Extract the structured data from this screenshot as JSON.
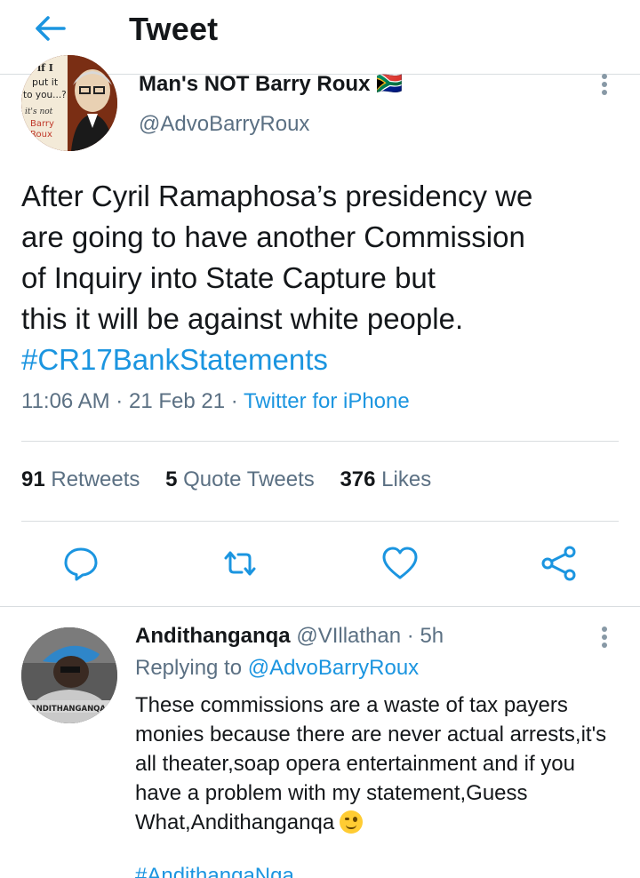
{
  "header": {
    "title": "Tweet",
    "back_icon": "arrow-left-icon"
  },
  "tweet": {
    "avatar_text": [
      "if I",
      "put it",
      "to you...?",
      "it's not",
      "Barry",
      "Roux"
    ],
    "display_name": "Man's NOT Barry Roux 🇿🇦",
    "handle": "@AdvoBarryRoux",
    "text_lines": [
      "After Cyril Ramaphosa’s presidency we",
      "are going to have another Commission",
      "of Inquiry into State Capture but",
      "this it will be against white people."
    ],
    "hashtag": "#CR17BankStatements",
    "time": "11:06 AM",
    "sep1": "·",
    "date": "21 Feb 21",
    "sep2": "·",
    "source": "Twitter for iPhone",
    "stats": {
      "retweets_count": "91",
      "retweets_label": "Retweets",
      "quotes_count": "5",
      "quotes_label": "Quote Tweets",
      "likes_count": "376",
      "likes_label": "Likes"
    },
    "action_icons": [
      "reply-icon",
      "retweet-icon",
      "like-icon",
      "share-icon"
    ]
  },
  "reply": {
    "avatar_text": "ANDITHANGANQA",
    "name": "Andithanganqa",
    "handle": "@VIllathan",
    "sep": "·",
    "time": "5h",
    "replying_prefix": "Replying to",
    "replying_handle": "@AdvoBarryRoux",
    "text_lines": [
      "These commissions are a waste of tax payers",
      "monies because there are never actual arrests,it's",
      "all theater,soap opera entertainment and if you",
      "have a problem with my statement,Guess",
      "What,Andithanganqa"
    ],
    "emoji": "winking-face-emoji",
    "hashtag": "#AndithangaNga"
  },
  "colors": {
    "accent": "#1b95e0",
    "text_primary": "#14171a",
    "text_secondary": "#5b7083",
    "divider": "#d9dde0"
  }
}
